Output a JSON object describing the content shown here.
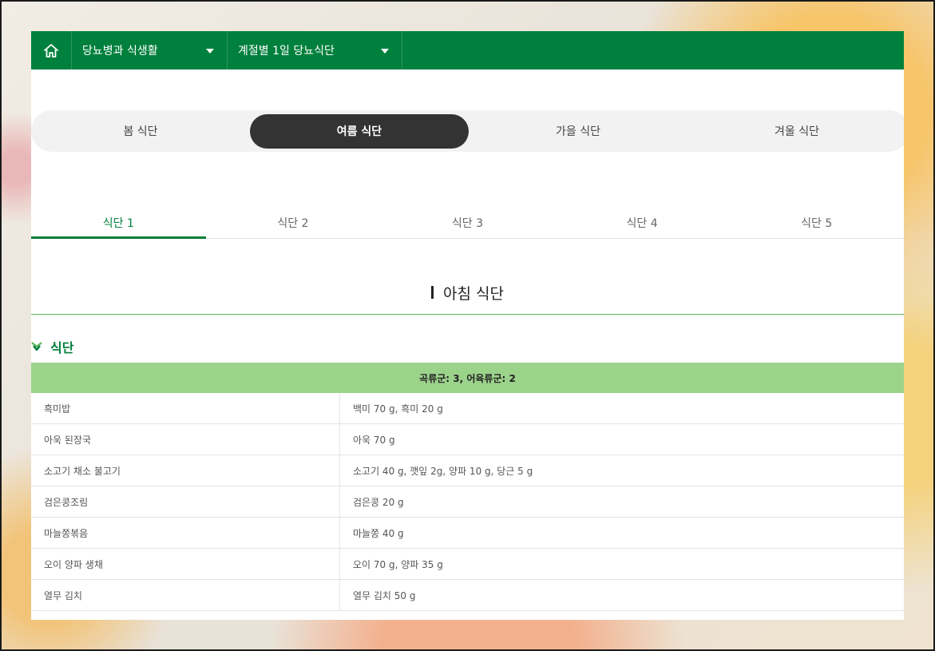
{
  "nav": {
    "home_icon": "home-icon",
    "dropdown1": "당뇨병과 식생활",
    "dropdown2": "계절별 1일 당뇨식단"
  },
  "season_tabs": [
    "봄 식단",
    "여름 식단",
    "가을 식단",
    "겨울 식단"
  ],
  "season_active": "여름 식단",
  "meal_tabs": [
    "식단 1",
    "식단 2",
    "식단 3",
    "식단 4",
    "식단 5"
  ],
  "meal_active": "식단 1",
  "section_title": "아침 식단",
  "sub_heading": "식단",
  "table": {
    "header": "곡류군: 3, 어육류군: 2",
    "rows": [
      {
        "name": "흑미밥",
        "ingredients": "백미 70 g, 흑미 20 g"
      },
      {
        "name": "아욱 된장국",
        "ingredients": "아욱 70 g"
      },
      {
        "name": "소고기 채소 불고기",
        "ingredients": "소고기 40 g, 깻잎 2g, 양파 10 g, 당근 5 g"
      },
      {
        "name": "검은콩조림",
        "ingredients": "검은콩 20 g"
      },
      {
        "name": "마늘쫑볶음",
        "ingredients": "마늘쫑 40 g"
      },
      {
        "name": "오이 양파 생채",
        "ingredients": "오이 70 g, 양파 35 g"
      },
      {
        "name": "열무 김치",
        "ingredients": "열무 김치 50 g"
      }
    ]
  },
  "colors": {
    "brand_green": "#00803d",
    "table_header_green": "#9cd38b",
    "active_season_bg": "#333333"
  }
}
